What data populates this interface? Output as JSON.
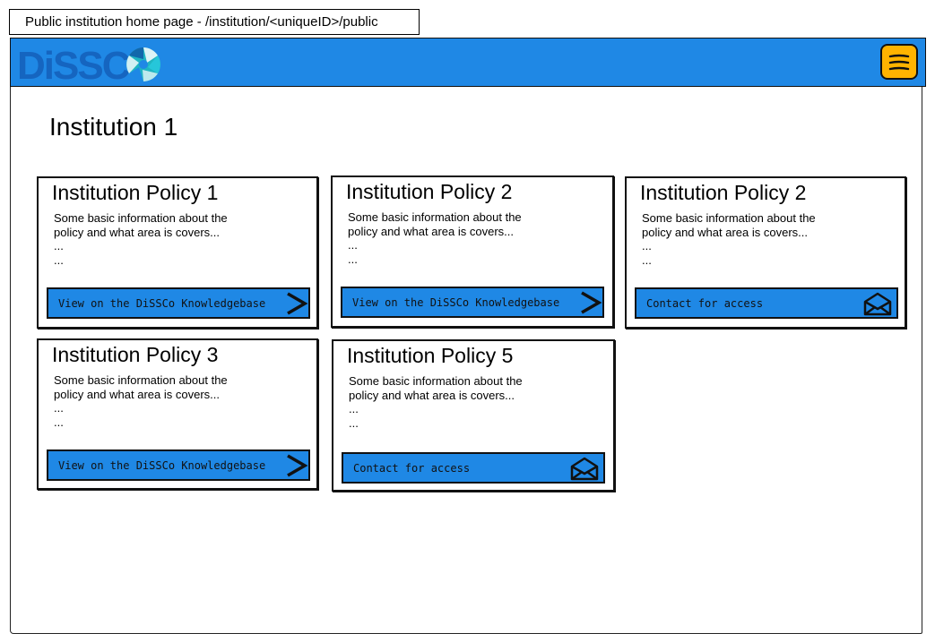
{
  "caption": "Public institution home page - /institution/<uniqueID>/public",
  "header": {
    "logo_text": "DiSSCo",
    "menu_icon": "hamburger-menu-icon",
    "colors": {
      "bar": "#1f88e5",
      "logo_text": "#1565c0",
      "menu": "#ffb300"
    }
  },
  "page_title": "Institution 1",
  "cards": [
    {
      "title": "Institution Policy 1",
      "lines": [
        "Some basic information about the",
        "policy and what area is covers...",
        "...",
        "..."
      ],
      "button_label": "View on the DiSSCo Knowledgebase",
      "button_icon": "chevron-right-icon"
    },
    {
      "title": "Institution Policy 2",
      "lines": [
        "Some basic information about the",
        "policy and what area is covers...",
        "...",
        "..."
      ],
      "button_label": "View on the DiSSCo Knowledgebase",
      "button_icon": "chevron-right-icon"
    },
    {
      "title": "Institution Policy 2",
      "lines": [
        "Some basic information about the",
        "policy and what area is covers...",
        "...",
        "..."
      ],
      "button_label": "Contact for access",
      "button_icon": "envelope-icon"
    },
    {
      "title": "Institution Policy 3",
      "lines": [
        "Some basic information about the",
        "policy and what area is covers...",
        "...",
        "..."
      ],
      "button_label": "View on the DiSSCo Knowledgebase",
      "button_icon": "chevron-right-icon"
    },
    {
      "title": "Institution Policy 5",
      "lines": [
        "Some basic information about the",
        "policy and what area is covers...",
        "...",
        "..."
      ],
      "button_label": "Contact for access",
      "button_icon": "envelope-icon"
    }
  ]
}
